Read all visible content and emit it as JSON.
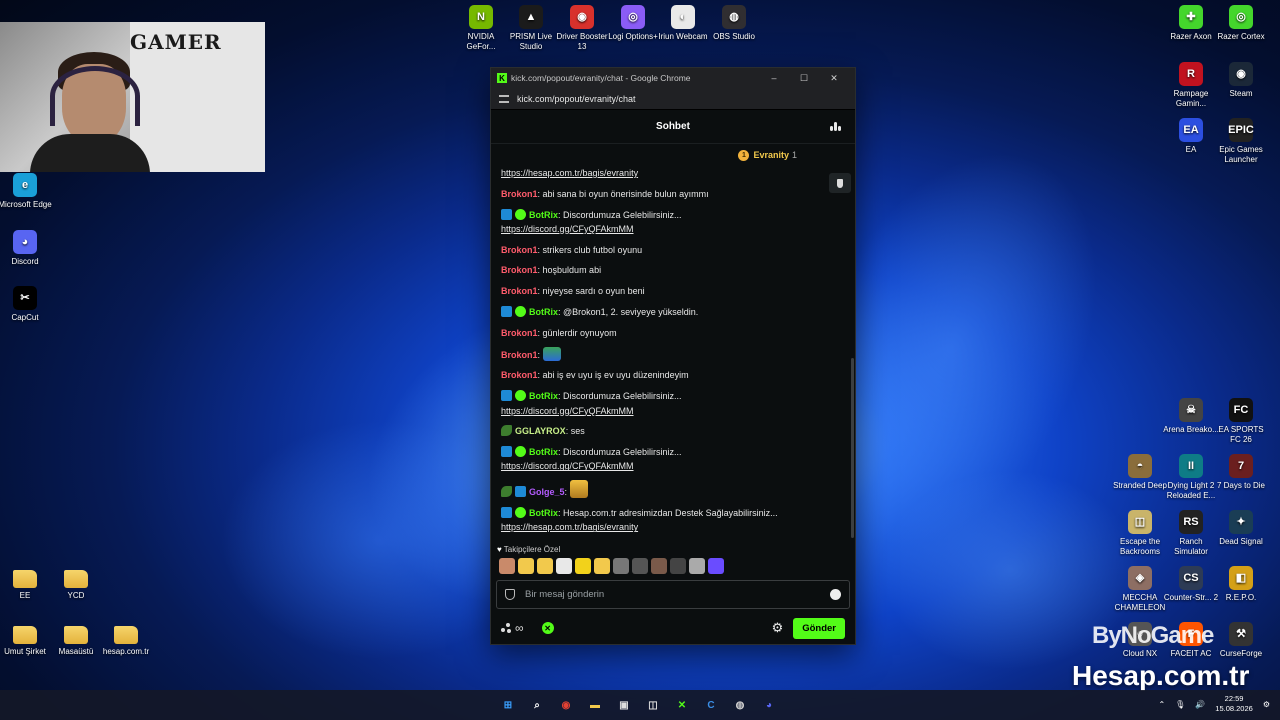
{
  "desktop": {
    "top_icons": [
      {
        "label": "NVIDIA GeFor...",
        "color": "#76b900",
        "glyph": "N"
      },
      {
        "label": "PRISM Live Studio",
        "color": "#1b1b1b",
        "glyph": "▲"
      },
      {
        "label": "Driver Booster 13",
        "color": "#d8312c",
        "glyph": "◉"
      },
      {
        "label": "Logi Options+",
        "color": "#8a5cf6",
        "glyph": "◎"
      },
      {
        "label": "Iriun Webcam",
        "color": "#e9e9e9",
        "glyph": "◐"
      },
      {
        "label": "OBS Studio",
        "color": "#302e31",
        "glyph": "◍"
      }
    ],
    "left_icons": [
      {
        "label": "Microsoft Edge",
        "color": "#1aa0d8",
        "glyph": "e"
      },
      {
        "label": "Discord",
        "color": "#5865f2",
        "glyph": "◕"
      },
      {
        "label": "CapCut",
        "color": "#000000",
        "glyph": "✂"
      }
    ],
    "folders": [
      {
        "label": "EE"
      },
      {
        "label": "YCD"
      },
      {
        "label": "Umut Şirket"
      },
      {
        "label": "Masaüstü"
      },
      {
        "label": "hesap.com.tr"
      }
    ],
    "right_icons": [
      {
        "label": "Razer Axon",
        "color": "#44d62c",
        "glyph": "✚"
      },
      {
        "label": "Razer Cortex",
        "color": "#44d62c",
        "glyph": "◎"
      },
      {
        "label": "Rampage Gamin...",
        "color": "#c1121f",
        "glyph": "R"
      },
      {
        "label": "Steam",
        "color": "#1b2838",
        "glyph": "◉"
      },
      {
        "label": "EA",
        "color": "#2c4fe0",
        "glyph": "EA"
      },
      {
        "label": "Epic Games Launcher",
        "color": "#222222",
        "glyph": "EPIC"
      },
      {
        "label": "Arena Breako...",
        "color": "#444444",
        "glyph": "☠"
      },
      {
        "label": "EA SPORTS FC 26",
        "color": "#111111",
        "glyph": "FC"
      },
      {
        "label": "Stranded Deep",
        "color": "#8a6d3b",
        "glyph": "◓"
      },
      {
        "label": "Dying Light 2 Reloaded E...",
        "color": "#0e7c86",
        "glyph": "II"
      },
      {
        "label": "7 Days to Die",
        "color": "#6b1f1f",
        "glyph": "7"
      },
      {
        "label": "Escape the Backrooms",
        "color": "#c9b46a",
        "glyph": "◫"
      },
      {
        "label": "Ranch Simulator",
        "color": "#222222",
        "glyph": "RS"
      },
      {
        "label": "Dead Signal",
        "color": "#1a3d55",
        "glyph": "✦"
      },
      {
        "label": "MECCHA CHAMELEON",
        "color": "#8d6e63",
        "glyph": "◈"
      },
      {
        "label": "Counter-Str... 2",
        "color": "#2d3b55",
        "glyph": "CS"
      },
      {
        "label": "R.E.P.O.",
        "color": "#d4a017",
        "glyph": "◧"
      },
      {
        "label": "Cloud NX",
        "color": "#555555",
        "glyph": "◌"
      },
      {
        "label": "FACEIT AC",
        "color": "#ff5500",
        "glyph": "F"
      },
      {
        "label": "CurseForge",
        "color": "#333333",
        "glyph": "⚒"
      }
    ]
  },
  "webcam": {
    "poster_text": "GAMER"
  },
  "browser": {
    "title": "kick.com/popout/evranity/chat - Google Chrome",
    "url": "kick.com/popout/evranity/chat",
    "minimize": "–",
    "maximize": "☐",
    "close": "✕"
  },
  "chat": {
    "header": "Sohbet",
    "pinned_user": "Evranity",
    "pinned_count": "1",
    "pinned_badge": "1",
    "messages": [
      {
        "type": "link",
        "text": "https://hesap.com.tr/bagis/evranity"
      },
      {
        "user": "Brokon1",
        "cls": "u-brokon",
        "badges": [],
        "text": "abi sana bi oyun önerisinde bulun ayımmı"
      },
      {
        "user": "BotRix",
        "cls": "u-botrix",
        "badges": [
          "bot",
          "ver"
        ],
        "text": "Discordumuza Gelebilirsiniz...",
        "link": "https://discord.gg/CFyQFAkmMM"
      },
      {
        "user": "Brokon1",
        "cls": "u-brokon",
        "badges": [],
        "text": "strikers club futbol oyunu"
      },
      {
        "user": "Brokon1",
        "cls": "u-brokon",
        "badges": [],
        "text": "hoşbuldum abi"
      },
      {
        "user": "Brokon1",
        "cls": "u-brokon",
        "badges": [],
        "text": "niyeyse sardı o oyun beni"
      },
      {
        "user": "BotRix",
        "cls": "u-botrix",
        "badges": [
          "bot",
          "ver"
        ],
        "text": "@Brokon1, 2. seviyeye yükseldin."
      },
      {
        "user": "Brokon1",
        "cls": "u-brokon",
        "badges": [],
        "text": "günlerdir oynuyom"
      },
      {
        "user": "Brokon1",
        "cls": "u-brokon",
        "badges": [],
        "text": "",
        "emote": "green"
      },
      {
        "user": "Brokon1",
        "cls": "u-brokon",
        "badges": [],
        "text": "abi iş ev uyu iş ev uyu düzenindeyim"
      },
      {
        "user": "BotRix",
        "cls": "u-botrix",
        "badges": [
          "bot",
          "ver"
        ],
        "text": "Discordumuza Gelebilirsiniz...",
        "link": "https://discord.gg/CFyQFAkmMM"
      },
      {
        "user": "GGLAYROX",
        "cls": "u-gglay",
        "badges": [
          "sub"
        ],
        "text": "ses"
      },
      {
        "user": "BotRix",
        "cls": "u-botrix",
        "badges": [
          "bot",
          "ver"
        ],
        "text": "Discordumuza Gelebilirsiniz...",
        "link": "https://discord.gg/CFyQFAkmMM"
      },
      {
        "user": "Golge_5",
        "cls": "u-golge",
        "badges": [
          "sub",
          "bot"
        ],
        "text": "",
        "emote": "gold"
      },
      {
        "user": "BotRix",
        "cls": "u-botrix",
        "badges": [
          "bot",
          "ver"
        ],
        "text": "Hesap.com.tr adresimizdan Destek Sağlayabilirsiniz...",
        "link": "https://hesap.com.tr/bagis/evranity"
      }
    ],
    "followers_label": "Takipçilere Özel",
    "emote_colors": [
      "#c98a6a",
      "#f2c94c",
      "#f2c94c",
      "#e8e8e8",
      "#f2d21b",
      "#f2c94c",
      "#777777",
      "#555555",
      "#7a5a4a",
      "#444444",
      "#aaaaaa",
      "#6a4cff"
    ],
    "input_placeholder": "Bir mesaj gönderin",
    "infinity": "∞",
    "send_label": "Gönder"
  },
  "taskbar": {
    "apps": [
      {
        "glyph": "⊞",
        "color": "#3aa0ff"
      },
      {
        "glyph": "⌕",
        "color": "#ffffff"
      },
      {
        "glyph": "◉",
        "color": "#e34133"
      },
      {
        "glyph": "▬",
        "color": "#f2c94c"
      },
      {
        "glyph": "▣",
        "color": "#dddddd"
      },
      {
        "glyph": "◫",
        "color": "#dddddd"
      },
      {
        "glyph": "✕",
        "color": "#53fc18"
      },
      {
        "glyph": "C",
        "color": "#3a8ee6"
      },
      {
        "glyph": "◍",
        "color": "#cfcfcf"
      },
      {
        "glyph": "◕",
        "color": "#5865f2"
      }
    ],
    "time": "22:59",
    "date": "15.08.2026"
  },
  "watermarks": {
    "line1": "ByNoGame",
    "line2": "Hesap.com.tr"
  }
}
